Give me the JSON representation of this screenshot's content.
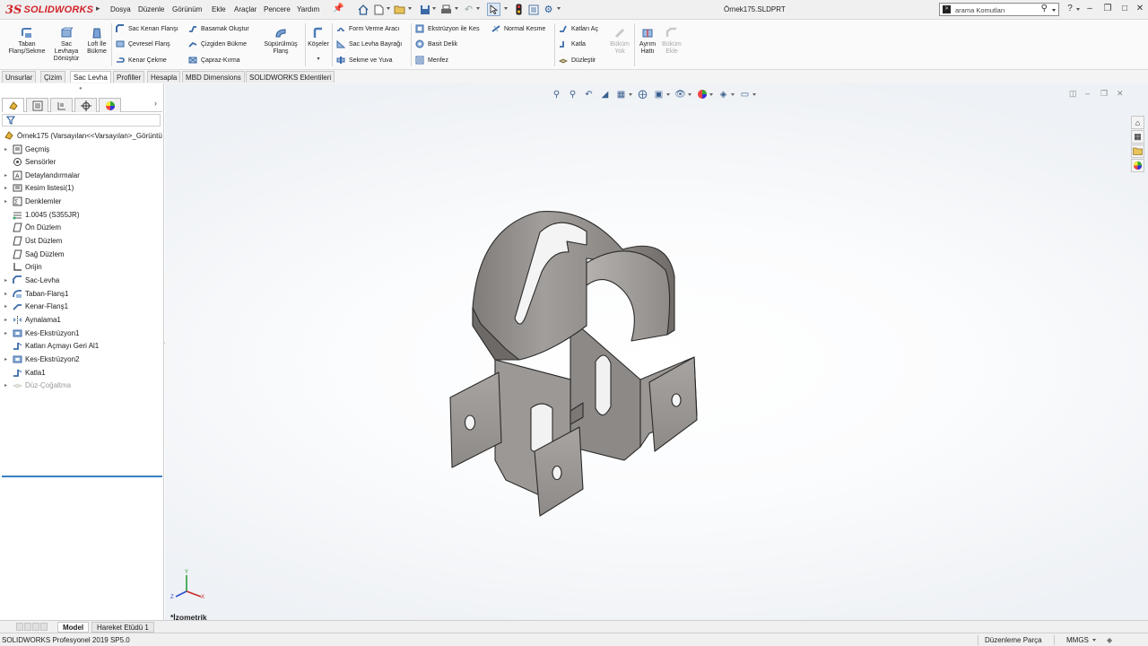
{
  "app": {
    "logo_ds": "3S",
    "logo_text": "SOLIDWORKS",
    "document_title": "Örnek175.SLDPRT"
  },
  "menu": [
    "Dosya",
    "Düzenle",
    "Görünüm",
    "Ekle",
    "Araçlar",
    "Pencere",
    "Yardım"
  ],
  "search": {
    "placeholder": "arama Komutları"
  },
  "ribbon": {
    "big": [
      {
        "label": "Taban Flanş/Sekme",
        "l1": "Taban",
        "l2": "Flanş/Sekme",
        "l3": ""
      },
      {
        "label": "Sac Levhaya Dönüştür",
        "l1": "Sac",
        "l2": "Levhaya",
        "l3": "Dönüştür"
      },
      {
        "label": "Loft İle Bükme",
        "l1": "Loft İle",
        "l2": "Bükme",
        "l3": ""
      },
      {
        "label": "Süpürülmüş Flanş",
        "l1": "Süpürülmüş",
        "l2": "Flanş",
        "l3": ""
      },
      {
        "label": "Köşeler",
        "l1": "Köşeler",
        "l2": "",
        "l3": ""
      },
      {
        "label": "Büküm Yok",
        "l1": "Büküm",
        "l2": "Yok",
        "l3": ""
      },
      {
        "label": "Ayrım Hattı",
        "l1": "Ayrım",
        "l2": "Hattı",
        "l3": ""
      },
      {
        "label": "Büküm Ekle",
        "l1": "Büküm",
        "l2": "Ekle",
        "l3": ""
      }
    ],
    "small": [
      "Sac Kenarı Flanşı",
      "Çevresel Flanş",
      "Kenar Çekme",
      "Basamak Oluştur",
      "Çizgiden Bükme",
      "Çapraz-Kırma",
      "Form Verme Aracı",
      "Sac Levha Bayrağı",
      "Sekme ve Yuva",
      "Ekstrüzyon ile Kes",
      "Basit Delik",
      "Menfez",
      "Normal Kesme",
      "Katları Aç",
      "Katla",
      "Düzleştir"
    ]
  },
  "command_tabs": [
    "Unsurlar",
    "Çizim",
    "Sac Levha",
    "Profiller",
    "Hesapla",
    "MBD Dimensions",
    "SOLIDWORKS Eklentileri"
  ],
  "command_tabs_active": "Sac Levha",
  "tree": {
    "root": "Örnek175  (Varsayılan<<Varsayılan>_Görüntü",
    "items": [
      {
        "label": "Geçmiş",
        "icon": "history-icon",
        "expand": true
      },
      {
        "label": "Sensörler",
        "icon": "sensor-icon",
        "expand": false
      },
      {
        "label": "Detaylandırmalar",
        "icon": "annotation-icon",
        "expand": true
      },
      {
        "label": "Kesim listesi(1)",
        "icon": "cut-list-icon",
        "expand": true
      },
      {
        "label": "Denklemler",
        "icon": "equation-icon",
        "expand": true
      },
      {
        "label": "1.0045 (S355JR)",
        "icon": "material-icon",
        "expand": false
      },
      {
        "label": "Ön Düzlem",
        "icon": "plane-icon",
        "expand": false
      },
      {
        "label": "Üst Düzlem",
        "icon": "plane-icon",
        "expand": false
      },
      {
        "label": "Sağ Düzlem",
        "icon": "plane-icon",
        "expand": false
      },
      {
        "label": "Orijin",
        "icon": "origin-icon",
        "expand": false
      },
      {
        "label": "Sac-Levha",
        "icon": "sheet-metal-icon",
        "expand": true
      },
      {
        "label": "Taban-Flanş1",
        "icon": "base-flange-icon",
        "expand": true
      },
      {
        "label": "Kenar-Flanş1",
        "icon": "edge-flange-icon",
        "expand": true
      },
      {
        "label": "Aynalama1",
        "icon": "mirror-icon",
        "expand": true
      },
      {
        "label": "Kes-Ekstrüzyon1",
        "icon": "cut-extrude-icon",
        "expand": true
      },
      {
        "label": "Katları Açmayı Geri Al1",
        "icon": "fold-icon",
        "expand": false
      },
      {
        "label": "Kes-Ekstrüzyon2",
        "icon": "cut-extrude-icon",
        "expand": true
      },
      {
        "label": "Katla1",
        "icon": "fold-icon",
        "expand": false
      },
      {
        "label": "Düz-Çoğaltma",
        "icon": "flat-pattern-icon",
        "expand": true,
        "suppressed": true
      }
    ]
  },
  "bottom_tabs": [
    "Model",
    "Hareket Etüdü 1"
  ],
  "bottom_tabs_active": "Model",
  "view_label": "*İzometrik",
  "status": {
    "product": "SOLIDWORKS Profesyonel 2019 SP5.0",
    "mode": "Düzenleme Parça",
    "units": "MMGS"
  },
  "colors": {
    "brand": "#d2232a",
    "part_fill": "#9b9794",
    "part_edge": "#2b2b2b",
    "selection_blue": "#3b7fc4"
  }
}
